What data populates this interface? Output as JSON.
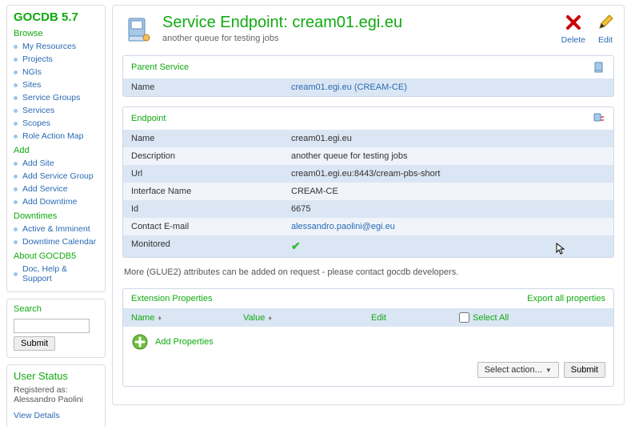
{
  "app": {
    "title": "GOCDB 5.7"
  },
  "sidebar": {
    "groups": [
      {
        "title": "Browse",
        "items": [
          "My Resources",
          "Projects",
          "NGIs",
          "Sites",
          "Service Groups",
          "Services",
          "Scopes",
          "Role Action Map"
        ]
      },
      {
        "title": "Add",
        "items": [
          "Add Site",
          "Add Service Group",
          "Add Service",
          "Add Downtime"
        ]
      },
      {
        "title": "Downtimes",
        "items": [
          "Active & Imminent",
          "Downtime Calendar"
        ]
      },
      {
        "title": "About GOCDB5",
        "items": [
          "Doc, Help & Support"
        ]
      }
    ]
  },
  "search": {
    "title": "Search",
    "submit": "Submit",
    "value": ""
  },
  "user_status": {
    "title": "User Status",
    "registered_label": "Registered as:",
    "registered_value": "Alessandro Paolini",
    "view_details": "View Details"
  },
  "header": {
    "title": "Service Endpoint: cream01.egi.eu",
    "subtitle": "another queue for testing jobs",
    "actions": {
      "delete": "Delete",
      "edit": "Edit"
    }
  },
  "parent_service": {
    "title": "Parent Service",
    "name_label": "Name",
    "name_value": "cream01.egi.eu (CREAM-CE)"
  },
  "endpoint": {
    "title": "Endpoint",
    "rows": [
      {
        "k": "Name",
        "v": "cream01.egi.eu"
      },
      {
        "k": "Description",
        "v": "another queue for testing jobs"
      },
      {
        "k": "Url",
        "v": "cream01.egi.eu:8443/cream-pbs-short"
      },
      {
        "k": "Interface Name",
        "v": "CREAM-CE"
      },
      {
        "k": "Id",
        "v": "6675"
      },
      {
        "k": "Contact E-mail",
        "v": "alessandro.paolini@egi.eu"
      },
      {
        "k": "Monitored",
        "v": "✔"
      }
    ]
  },
  "note": "More (GLUE2) attributes can be added on request - please contact gocdb developers.",
  "extensions": {
    "title": "Extension Properties",
    "export": "Export all properties",
    "cols": {
      "name": "Name",
      "value": "Value",
      "edit": "Edit",
      "select_all": "Select All"
    },
    "add_label": "Add Properties",
    "select_action": "Select action...",
    "submit": "Submit"
  }
}
